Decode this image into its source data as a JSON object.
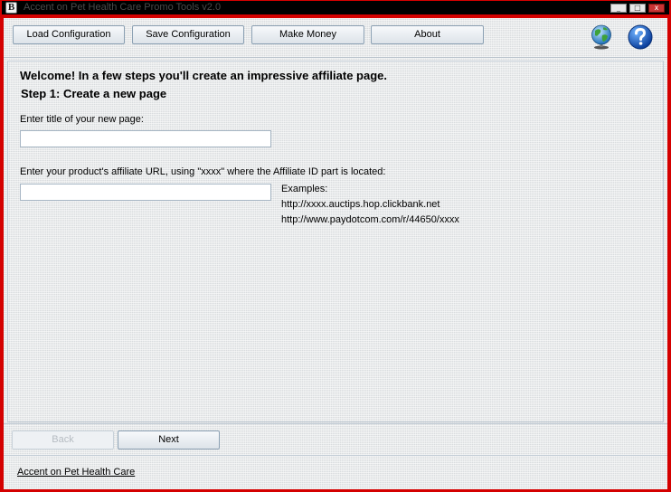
{
  "window": {
    "title": "Accent on Pet Health Care Promo Tools v2.0",
    "app_icon_glyph": "B",
    "controls": {
      "minimize": "_",
      "maximize": "□",
      "close": "x"
    }
  },
  "toolbar": {
    "buttons": [
      {
        "label": "Load Configuration"
      },
      {
        "label": "Save Configuration"
      },
      {
        "label": "Make Money"
      },
      {
        "label": "About"
      }
    ],
    "icons": [
      "globe-icon",
      "help-icon"
    ]
  },
  "page": {
    "welcome": "Welcome! In a few steps you'll create an impressive affiliate page.",
    "step": "Step 1: Create a new page",
    "title_field": {
      "label": "Enter title of your new page:",
      "value": ""
    },
    "url_field": {
      "label": "Enter your product's affiliate URL, using \"xxxx\" where the Affiliate ID part is located:",
      "value": ""
    },
    "examples": {
      "heading": "Examples:",
      "items": [
        "http://xxxx.auctips.hop.clickbank.net",
        "http://www.paydotcom.com/r/44650/xxxx"
      ]
    }
  },
  "navigation": {
    "back_label": "Back",
    "next_label": "Next"
  },
  "footer": {
    "link": "Accent on Pet Health Care "
  },
  "colors": {
    "window_border": "#d40000",
    "titlebar": "#000000",
    "button_border": "#8ba0b3"
  }
}
